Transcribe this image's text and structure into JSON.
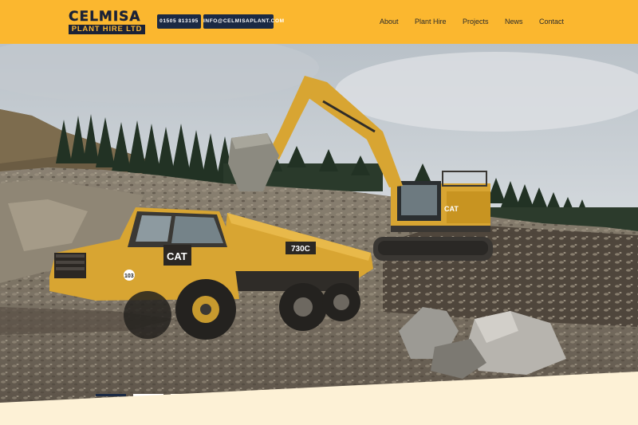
{
  "header": {
    "logo": {
      "line1": "CELMISA",
      "line2": "PLANT HIRE LTD"
    },
    "phone": "01505 813195",
    "email": "INFO@CELMISAPLANT.COM"
  },
  "nav": {
    "items": [
      {
        "label": "About"
      },
      {
        "label": "Plant Hire"
      },
      {
        "label": "Projects"
      },
      {
        "label": "News"
      },
      {
        "label": "Contact"
      }
    ]
  },
  "hero": {
    "dump_truck_model": "730C",
    "dump_truck_brand": "CAT",
    "excavator_brand": "CAT",
    "fleet_number": "103",
    "slides": [
      {
        "active": true
      },
      {
        "active": false
      },
      {
        "active": false
      },
      {
        "active": false
      },
      {
        "active": false
      }
    ]
  },
  "colors": {
    "header_bg": "#fbb72f",
    "brand_navy": "#1b2a44",
    "footer_band": "#fdf1d6",
    "machine_yellow": "#d8a532"
  },
  "icons": [
    "logo-mark"
  ]
}
